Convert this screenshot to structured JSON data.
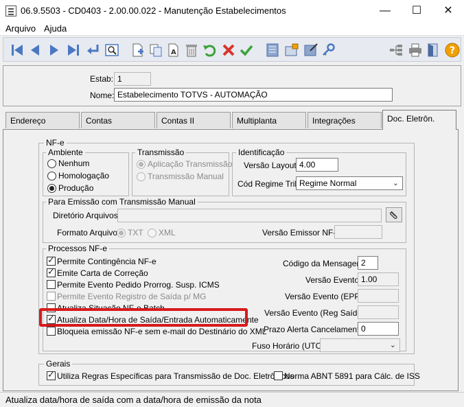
{
  "window": {
    "title": "06.9.5503 - CD0403 - 2.00.00.022 - Manutenção Estabelecimentos",
    "minimize": "—",
    "maximize": "☐",
    "close": "✕"
  },
  "menu": {
    "arquivo": "Arquivo",
    "ajuda": "Ajuda"
  },
  "toolbar_icons": [
    "first-icon",
    "previous-icon",
    "next-icon",
    "last-icon",
    "goto-icon",
    "search-icon",
    "add-icon",
    "copy-icon",
    "edit-icon",
    "delete-icon",
    "undo-icon",
    "cancel-icon",
    "save-icon",
    "list-icon",
    "zoom-icon",
    "report-icon",
    "key-icon",
    "tree-icon",
    "print-icon",
    "exit-icon",
    "help-icon"
  ],
  "header": {
    "estab_label": "Estab:",
    "estab_value": "1",
    "nome_label": "Nome:",
    "nome_value": "Estabelecimento TOTVS - AUTOMAÇÃO"
  },
  "tabs": [
    "Endereço",
    "Contas",
    "Contas II",
    "Multiplanta",
    "Integrações",
    "Doc. Eletrôn."
  ],
  "active_tab": "Doc. Eletrôn.",
  "nfe": {
    "title": "NF-e",
    "ambiente": {
      "title": "Ambiente",
      "options": [
        "Nenhum",
        "Homologação",
        "Produção"
      ],
      "selected": "Produção"
    },
    "transmissao": {
      "title": "Transmissão",
      "options": [
        "Aplicação Transmissão",
        "Transmissão Manual"
      ],
      "selected": "Aplicação Transmissão"
    },
    "identificacao": {
      "title": "Identificação",
      "versao_layout_label": "Versão Layout:",
      "versao_layout_value": "4.00",
      "cod_regime_label": "Cód Regime Trib:",
      "cod_regime_value": "Regime Normal"
    },
    "emissao_manual": {
      "title": "Para Emissão com Transmissão Manual",
      "diretorio_label": "Diretório Arquivos:",
      "diretorio_value": "",
      "formato_label": "Formato Arquivo:",
      "formato_options": [
        "TXT",
        "XML"
      ],
      "formato_selected": "TXT",
      "versao_emissor_label": "Versão Emissor NF-e:",
      "versao_emissor_value": ""
    },
    "processos": {
      "title": "Processos NF-e",
      "checkboxes": [
        {
          "label": "Permite Contingência NF-e",
          "checked": true
        },
        {
          "label": "Emite Carta de Correção",
          "checked": true
        },
        {
          "label": "Permite Evento Pedido Prorrog. Susp. ICMS",
          "checked": false
        },
        {
          "label": "Permite Evento Registro de Saída p/ MG",
          "checked": false,
          "disabled": true
        },
        {
          "label": "Atualiza Situação NF-e Batch",
          "checked": false
        },
        {
          "label": "Atualiza Data/Hora de Saída/Entrada Automaticamente",
          "checked": true
        },
        {
          "label": "Bloqueia emissão NF-e sem e-mail do Destinário do XML",
          "checked": false
        }
      ],
      "codigo_mensagem_label": "Código da Mensagem:",
      "codigo_mensagem_value": "2",
      "versao_evento_label": "Versão Evento:",
      "versao_evento_value": "1.00",
      "versao_evento_epp_label": "Versão Evento (EPP):",
      "versao_evento_epp_value": "",
      "versao_evento_reg_label": "Versão Evento (Reg Saída):",
      "versao_evento_reg_value": "",
      "prazo_alerta_label": "Prazo Alerta Cancelamento:",
      "prazo_alerta_value": "0",
      "fuso_label": "Fuso Horário (UTC):",
      "fuso_value": ""
    }
  },
  "gerais": {
    "title": "Gerais",
    "utiliza_regras_label": "Utiliza Regras Específicas para Transmissão de Doc. Eletrônicos",
    "utiliza_regras_checked": true,
    "norma_abnt_label": "Norma ABNT 5891 para Cálc. de ISS",
    "norma_abnt_checked": false
  },
  "status_bar": "Atualiza data/hora de saída com a data/hora de emissão da nota",
  "colors": {
    "highlight": "#d61a1a",
    "toolbar_icon_blue": "#4a78c2",
    "cancel_red": "#d9342b",
    "save_green": "#3aa33a",
    "help_orange": "#f0a000"
  }
}
